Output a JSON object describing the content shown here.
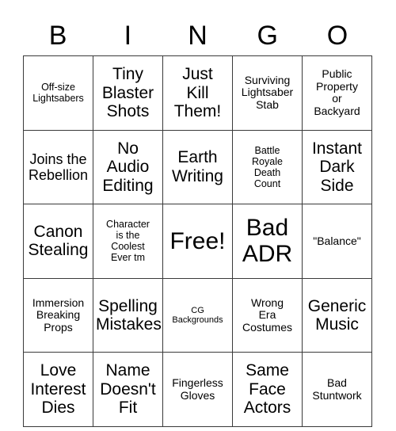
{
  "card": {
    "header_letters": [
      "B",
      "I",
      "N",
      "G",
      "O"
    ],
    "grid_columns": 5,
    "grid_rows": 5,
    "border_color": "#3a3a3a",
    "background_color": "#ffffff",
    "text_color": "#000000",
    "cells": [
      [
        {
          "text": "Off-size\nLightsabers",
          "size": "sm"
        },
        {
          "text": "Tiny\nBlaster\nShots",
          "size": "xl"
        },
        {
          "text": "Just\nKill\nThem!",
          "size": "xl"
        },
        {
          "text": "Surviving\nLightsaber\nStab",
          "size": "md"
        },
        {
          "text": "Public\nProperty\nor\nBackyard",
          "size": "md"
        }
      ],
      [
        {
          "text": "Joins the\nRebellion",
          "size": "lg"
        },
        {
          "text": "No\nAudio\nEditing",
          "size": "xl"
        },
        {
          "text": "Earth\nWriting",
          "size": "xl"
        },
        {
          "text": "Battle\nRoyale\nDeath\nCount",
          "size": "sm"
        },
        {
          "text": "Instant\nDark\nSide",
          "size": "xl"
        }
      ],
      [
        {
          "text": "Canon\nStealing",
          "size": "xl"
        },
        {
          "text": "Character\nis the\nCoolest\nEver tm",
          "size": "sm"
        },
        {
          "text": "Free!",
          "size": "xxl"
        },
        {
          "text": "Bad\nADR",
          "size": "xxl"
        },
        {
          "text": "\"Balance\"",
          "size": "md"
        }
      ],
      [
        {
          "text": "Immersion\nBreaking\nProps",
          "size": "md"
        },
        {
          "text": "Spelling\nMistakes",
          "size": "xl"
        },
        {
          "text": "CG\nBackgrounds",
          "size": "xs"
        },
        {
          "text": "Wrong\nEra\nCostumes",
          "size": "md"
        },
        {
          "text": "Generic\nMusic",
          "size": "xl"
        }
      ],
      [
        {
          "text": "Love\nInterest\nDies",
          "size": "xl"
        },
        {
          "text": "Name\nDoesn't\nFit",
          "size": "xl"
        },
        {
          "text": "Fingerless\nGloves",
          "size": "md"
        },
        {
          "text": "Same\nFace\nActors",
          "size": "xl"
        },
        {
          "text": "Bad\nStuntwork",
          "size": "md"
        }
      ]
    ]
  }
}
